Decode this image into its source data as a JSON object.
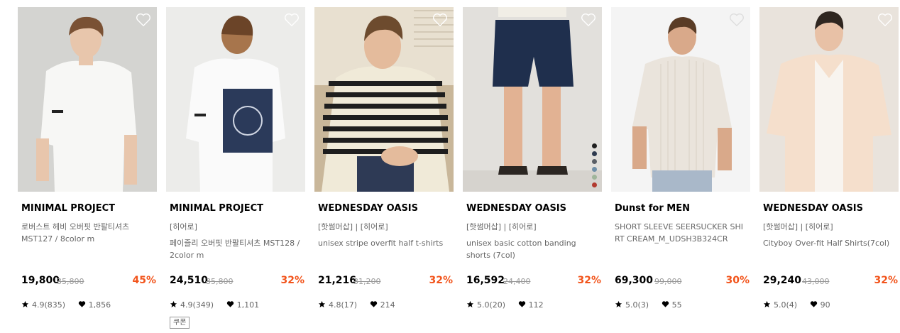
{
  "products": [
    {
      "brand": "MINIMAL PROJECT",
      "tags": "",
      "name": "로버스트 헤비 오버핏 반팔티셔츠 MST127 / 8color m",
      "price": "19,800",
      "original_price": "35,800",
      "discount": "45%",
      "rating": "4.9(835)",
      "likes": "1,856",
      "coupon": "",
      "swatches": []
    },
    {
      "brand": "MINIMAL PROJECT",
      "tags": "[히어로]",
      "name": "페이즐리 오버핏 반팔티셔츠 MST128 / 2color m",
      "price": "24,510",
      "original_price": "35,800",
      "discount": "32%",
      "rating": "4.9(349)",
      "likes": "1,101",
      "coupon": "쿠폰",
      "swatches": []
    },
    {
      "brand": "WEDNESDAY OASIS",
      "tags": "[핫썸머삽] | [히어로]",
      "name": "unisex stripe overfit half t-shirts",
      "price": "21,216",
      "original_price": "31,200",
      "discount": "32%",
      "rating": "4.8(17)",
      "likes": "214",
      "coupon": "",
      "swatches": []
    },
    {
      "brand": "WEDNESDAY OASIS",
      "tags": "[핫썸머삽] | [히어로]",
      "name": "unisex basic cotton banding shorts (7col)",
      "price": "16,592",
      "original_price": "24,400",
      "discount": "32%",
      "rating": "5.0(20)",
      "likes": "112",
      "coupon": "",
      "swatches": [
        "#1f1f1f",
        "#2e3a4f",
        "#5a5f66",
        "#6f8fa8",
        "#9fb59a",
        "#b23a2f"
      ]
    },
    {
      "brand": "Dunst for MEN",
      "tags": "",
      "name": "SHORT SLEEVE SEERSUCKER SHIRT CREAM_M_UDSH3B324CR",
      "price": "69,300",
      "original_price": "99,000",
      "discount": "30%",
      "rating": "5.0(3)",
      "likes": "55",
      "coupon": "",
      "swatches": []
    },
    {
      "brand": "WEDNESDAY OASIS",
      "tags": "[핫썸머삽] | [히어로]",
      "name": "Cityboy Over-fit Half Shirts(7col)",
      "price": "29,240",
      "original_price": "43,000",
      "discount": "32%",
      "rating": "5.0(4)",
      "likes": "90",
      "coupon": "",
      "swatches": []
    }
  ],
  "icons": {
    "wishlist": "heart-outline-icon",
    "rating": "star-icon",
    "likes": "heart-icon"
  },
  "colors": {
    "discount": "#f2541b",
    "text": "#000000",
    "muted": "#666666"
  }
}
